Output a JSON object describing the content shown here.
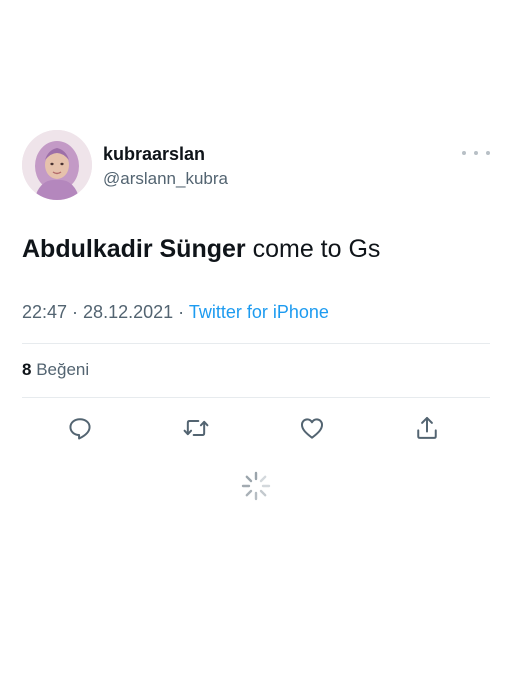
{
  "author": {
    "display_name": "kubraarslan",
    "handle": "@arslann_kubra",
    "avatar": "profile-photo"
  },
  "tweet": {
    "mention": "Abdulkadir Sünger",
    "text": " come to Gs",
    "time": "22:47",
    "separator": " · ",
    "date": "28.12.2021",
    "source": "Twitter for iPhone"
  },
  "stats": {
    "likes_count": "8",
    "likes_label": " Beğeni"
  },
  "actions": {
    "reply": "reply-icon",
    "retweet": "retweet-icon",
    "like": "heart-icon",
    "share": "share-icon"
  },
  "colors": {
    "text": "#0f1419",
    "muted": "#536471",
    "link": "#1d9bf0",
    "divider": "#e7ebee"
  }
}
